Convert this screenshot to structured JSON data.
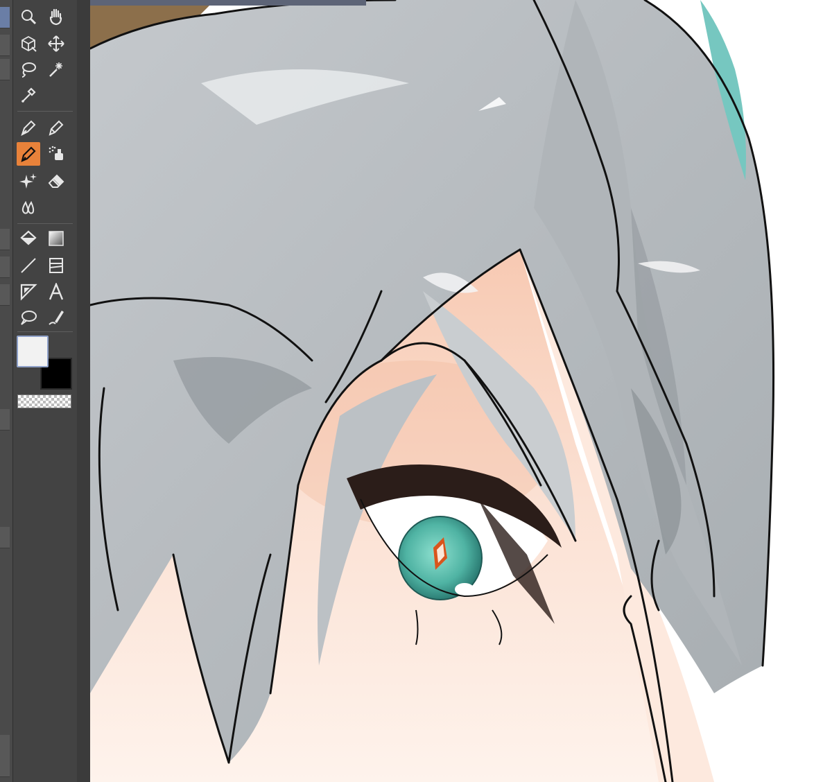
{
  "document_tab": {
    "title": ""
  },
  "tools": [
    {
      "id": "zoom",
      "icon": "magnifier-icon"
    },
    {
      "id": "hand",
      "icon": "hand-icon"
    },
    {
      "id": "object",
      "icon": "object-cube-icon"
    },
    {
      "id": "move",
      "icon": "move-arrows-icon"
    },
    {
      "id": "lasso",
      "icon": "lasso-icon"
    },
    {
      "id": "auto-select",
      "icon": "magic-wand-icon"
    },
    {
      "id": "eyedropper",
      "icon": "eyedropper-icon"
    },
    {
      "id": "pen",
      "icon": "pen-nib-icon"
    },
    {
      "id": "pencil",
      "icon": "pencil-icon"
    },
    {
      "id": "brush",
      "icon": "brush-icon",
      "active": true
    },
    {
      "id": "airbrush",
      "icon": "airbrush-icon"
    },
    {
      "id": "decoration",
      "icon": "sparkle-icon"
    },
    {
      "id": "eraser",
      "icon": "eraser-icon"
    },
    {
      "id": "blend",
      "icon": "blend-drops-icon"
    },
    {
      "id": "fill",
      "icon": "fill-bucket-icon"
    },
    {
      "id": "gradient",
      "icon": "gradient-icon"
    },
    {
      "id": "figure",
      "icon": "line-icon"
    },
    {
      "id": "frame",
      "icon": "frame-border-icon"
    },
    {
      "id": "ruler",
      "icon": "ruler-triangle-icon"
    },
    {
      "id": "text",
      "icon": "text-a-icon"
    },
    {
      "id": "balloon",
      "icon": "speech-balloon-icon"
    },
    {
      "id": "correct-line",
      "icon": "correct-line-icon"
    }
  ],
  "colors": {
    "main_color": "#f2f2f2",
    "sub_color": "#000000",
    "accent_active_tool": "#e8823a",
    "hair": "#b9bec2",
    "hair_shadow": "#8f969b",
    "skin": "#fbe3d6",
    "iris": "#5fc2b0",
    "pupil_highlight": "#d9551c"
  }
}
